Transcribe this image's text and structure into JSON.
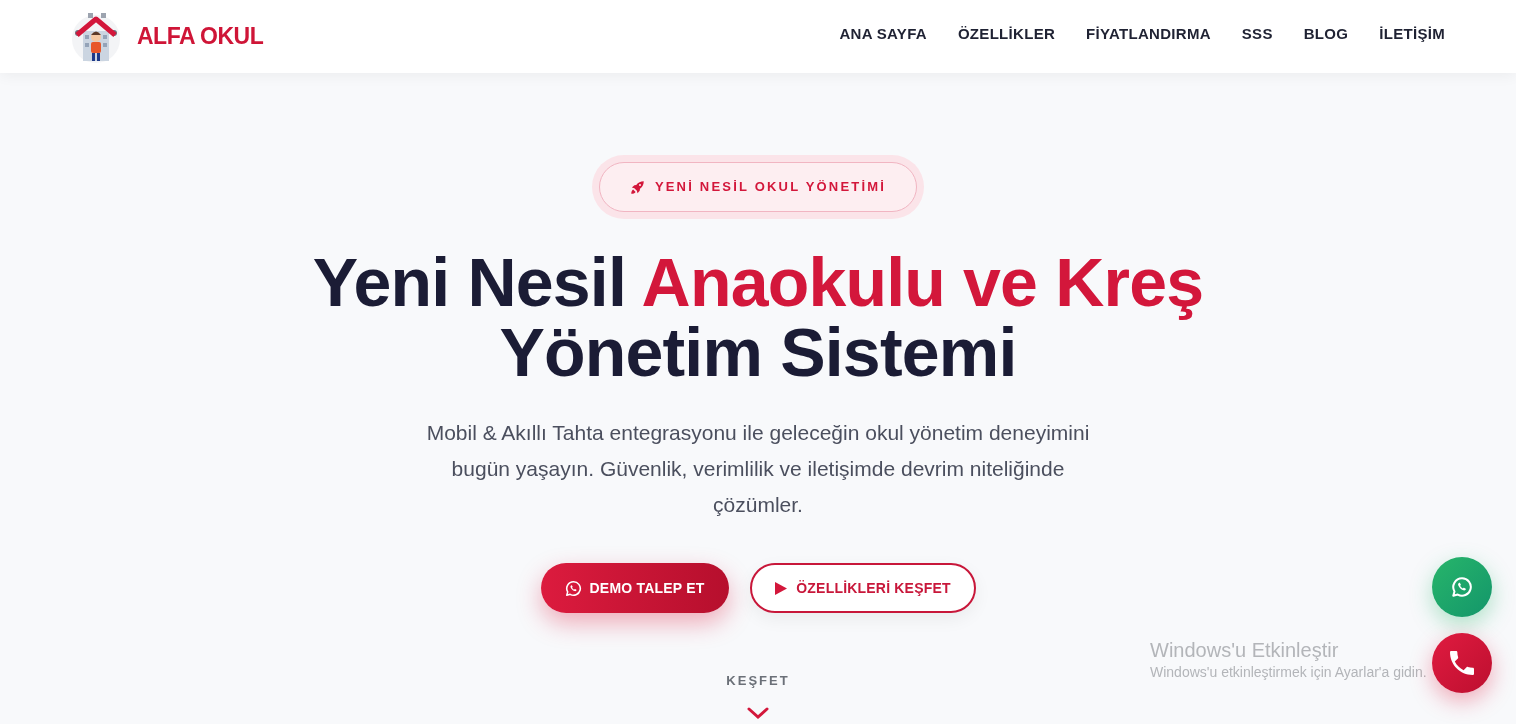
{
  "header": {
    "logo_text": "ALFA OKUL",
    "nav": [
      {
        "label": "ANA SAYFA"
      },
      {
        "label": "ÖZELLİKLER"
      },
      {
        "label": "FİYATLANDIRMA"
      },
      {
        "label": "SSS"
      },
      {
        "label": "BLOG"
      },
      {
        "label": "İLETİŞİM"
      }
    ]
  },
  "hero": {
    "badge": "YENİ NESİL OKUL YÖNETİMİ",
    "title_lines": [
      {
        "parts": [
          {
            "text": "Yeni Nesil",
            "highlight": false
          },
          {
            "text": "Anaokulu ve Kreş",
            "highlight": true
          }
        ]
      },
      {
        "parts": [
          {
            "text": "Yönetim Sistemi",
            "highlight": false
          }
        ]
      }
    ],
    "description": "Mobil & Akıllı Tahta entegrasyonu ile geleceğin okul yönetim deneyimini bugün yaşayın. Güvenlik, verimlilik ve iletişimde devrim niteliğinde çözümler.",
    "buttons": [
      {
        "kind": "primary",
        "label": "DEMO TALEP ET"
      },
      {
        "kind": "outline",
        "label": "ÖZELLİKLERİ KEŞFET"
      }
    ],
    "scroll_hint": {
      "label": "KEŞFET"
    }
  },
  "floating_buttons": [
    {
      "kind": "chat"
    },
    {
      "kind": "call"
    }
  ],
  "activation_notice": {
    "title": "Windows'u Etkinleştir",
    "text": "Windows'u etkinleştirmek için Ayarlar'a gidin."
  }
}
